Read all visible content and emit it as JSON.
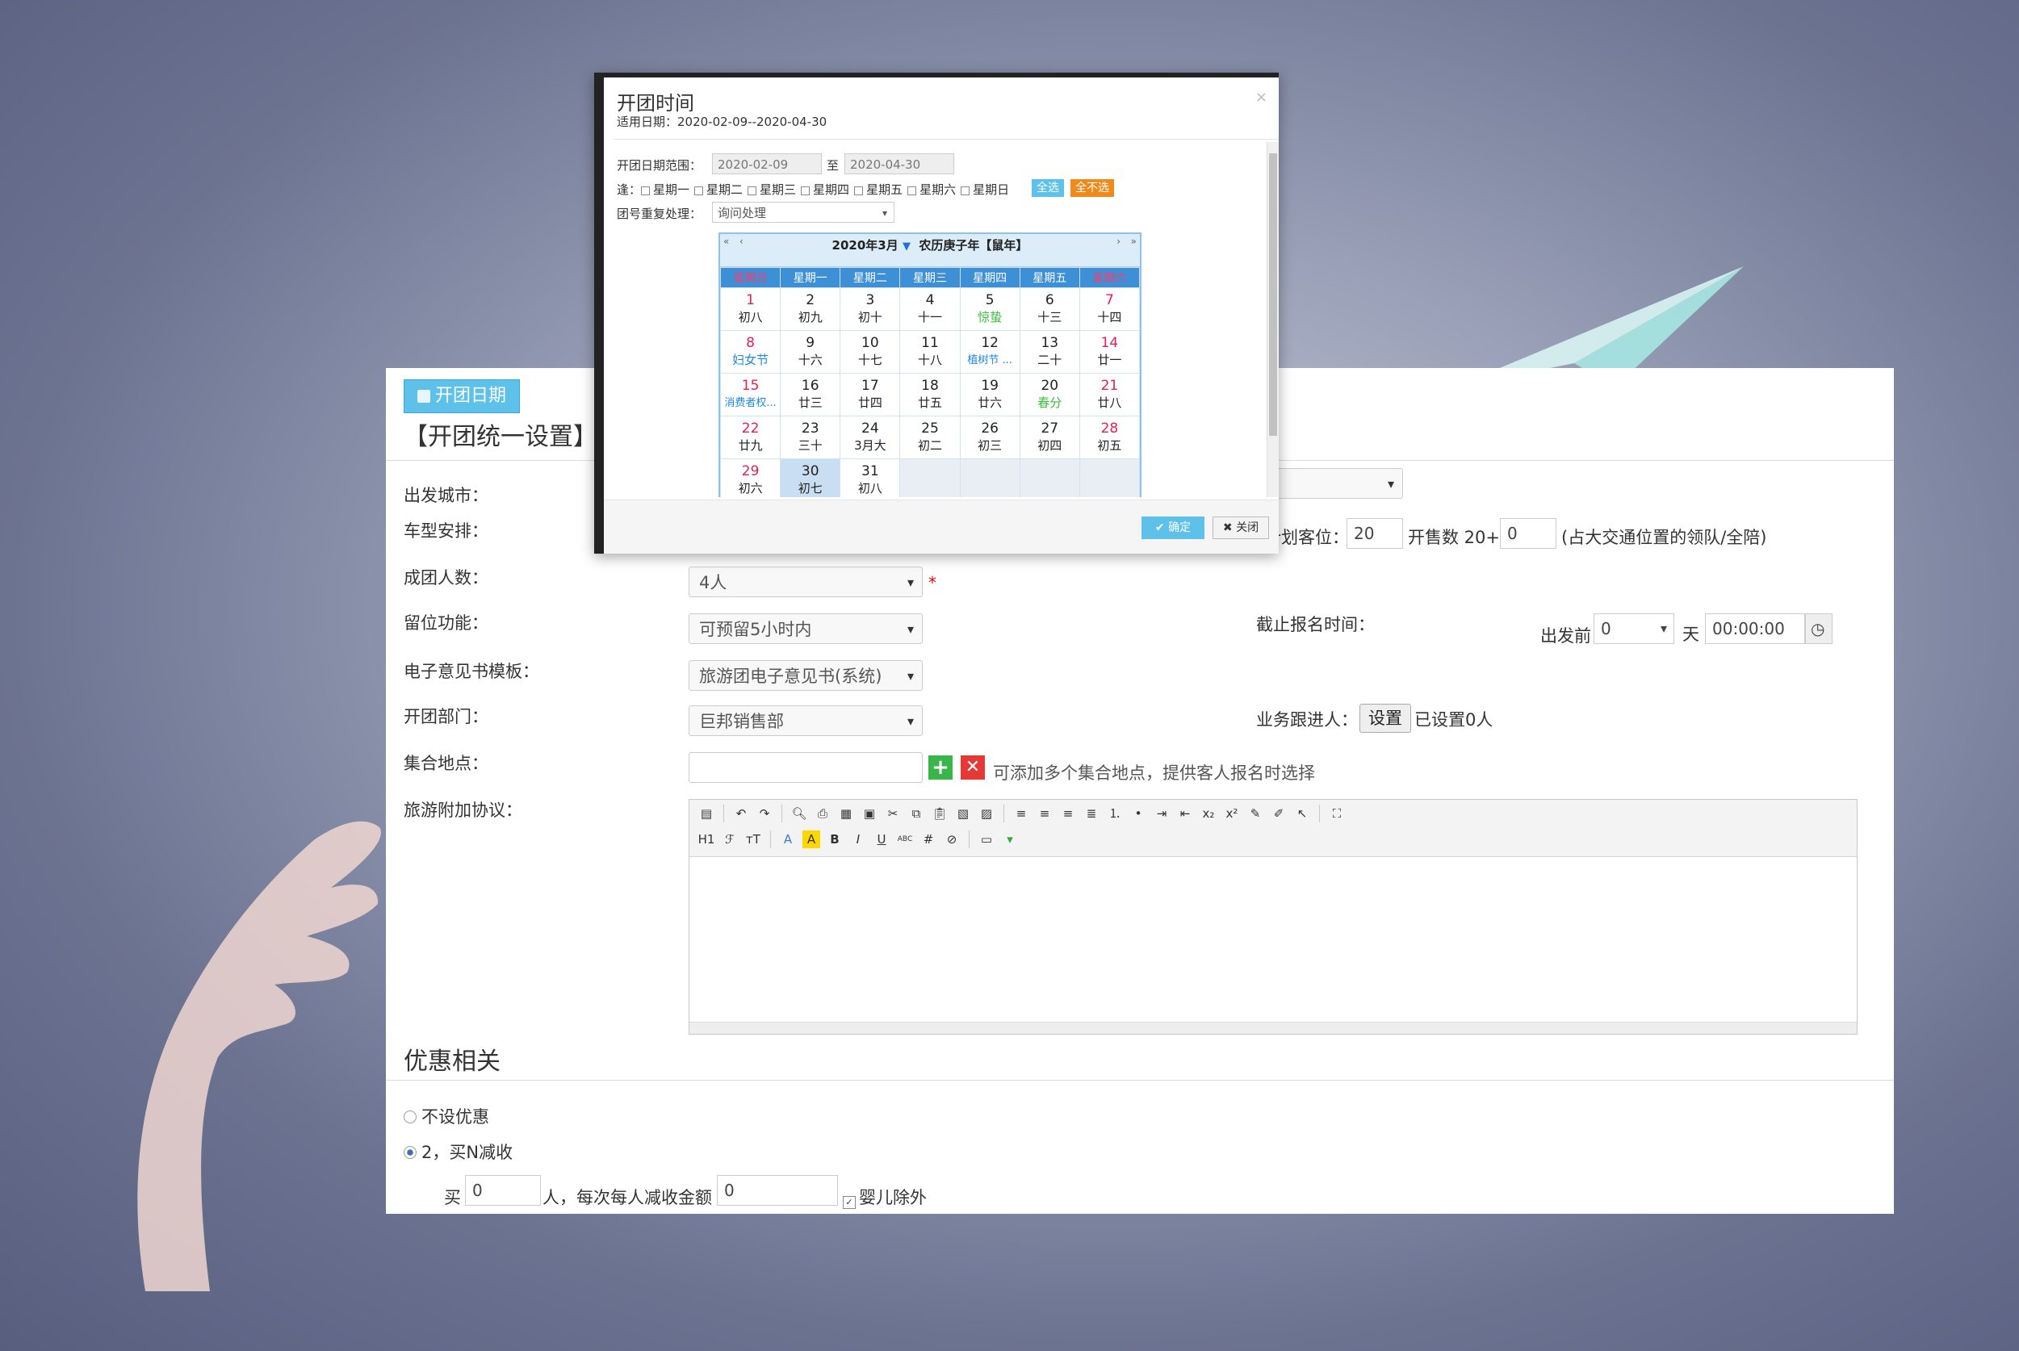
{
  "form": {
    "tab_label": "开团日期",
    "section_title": "【开团统一设置】注",
    "labels": {
      "city": "出发城市：",
      "vehicle": "车型安排：",
      "group_size": "成团人数：",
      "hold": "留位功能：",
      "feedback": "电子意见书模板：",
      "dept": "开团部门：",
      "meeting": "集合地点：",
      "agreement": "旅游附加协议："
    },
    "values": {
      "group_size": "4人",
      "hold": "可预留5小时内",
      "feedback": "旅游团电子意见书(系统)",
      "dept": "巨邦销售部",
      "meeting": ""
    },
    "seat_plan": {
      "label": "计划客位：",
      "seats": "20",
      "open_label": "开售数 20+",
      "open_extra": "0",
      "note": "(占大交通位置的领队/全陪)"
    },
    "deadline": {
      "label": "截止报名时间：",
      "before": "出发前",
      "days": "0",
      "day_unit": "天",
      "time": "00:00:00"
    },
    "follower": {
      "label": "业务跟进人：",
      "button": "设置",
      "status": "已设置0人"
    },
    "meeting_hint": "可添加多个集合地点，提供客人报名时选择",
    "discount": {
      "title": "优惠相关",
      "option_none": "不设优惠",
      "option_buy": "2，买N减收",
      "buy_prefix": "买",
      "buy_n": "0",
      "buy_mid": "人，每次每人减收金额",
      "amount": "0",
      "infant_excluded": "婴儿除外"
    }
  },
  "modal": {
    "title": "开团时间",
    "subtitle": "适用日期：2020-02-09--2020-04-30",
    "range_label": "开团日期范围：",
    "range_from": "2020-02-09",
    "range_to_label": "至",
    "range_to": "2020-04-30",
    "weekday_prefix": "逢：",
    "weekday_options": [
      "星期一",
      "星期二",
      "星期三",
      "星期四",
      "星期五",
      "星期六",
      "星期日"
    ],
    "select_all": "全选",
    "select_none": "全不选",
    "repeat_label": "团号重复处理：",
    "repeat_value": "询问处理",
    "ok": "确定",
    "close": "关闭",
    "calendar": {
      "year_month": "2020年3月",
      "lunar": "农历庚子年【鼠年】",
      "weekdays": [
        "星期日",
        "星期一",
        "星期二",
        "星期三",
        "星期四",
        "星期五",
        "星期六"
      ],
      "weeks": [
        [
          {
            "d": "1",
            "l": "初八"
          },
          {
            "d": "2",
            "l": "初九"
          },
          {
            "d": "3",
            "l": "初十"
          },
          {
            "d": "4",
            "l": "十一"
          },
          {
            "d": "5",
            "l": "惊蛰"
          },
          {
            "d": "6",
            "l": "十三"
          },
          {
            "d": "7",
            "l": "十四"
          }
        ],
        [
          {
            "d": "8",
            "l": "妇女节"
          },
          {
            "d": "9",
            "l": "十六"
          },
          {
            "d": "10",
            "l": "十七"
          },
          {
            "d": "11",
            "l": "十八"
          },
          {
            "d": "12",
            "l": "植树节 ..."
          },
          {
            "d": "13",
            "l": "二十"
          },
          {
            "d": "14",
            "l": "廿一"
          }
        ],
        [
          {
            "d": "15",
            "l": "消费者权..."
          },
          {
            "d": "16",
            "l": "廿三"
          },
          {
            "d": "17",
            "l": "廿四"
          },
          {
            "d": "18",
            "l": "廿五"
          },
          {
            "d": "19",
            "l": "廿六"
          },
          {
            "d": "20",
            "l": "春分"
          },
          {
            "d": "21",
            "l": "廿八"
          }
        ],
        [
          {
            "d": "22",
            "l": "廿九"
          },
          {
            "d": "23",
            "l": "三十"
          },
          {
            "d": "24",
            "l": "3月大"
          },
          {
            "d": "25",
            "l": "初二"
          },
          {
            "d": "26",
            "l": "初三"
          },
          {
            "d": "27",
            "l": "初四"
          },
          {
            "d": "28",
            "l": "初五"
          }
        ],
        [
          {
            "d": "29",
            "l": "初六"
          },
          {
            "d": "30",
            "l": "初七"
          },
          {
            "d": "31",
            "l": "初八"
          },
          {
            "d": "",
            "l": ""
          },
          {
            "d": "",
            "l": ""
          },
          {
            "d": "",
            "l": ""
          },
          {
            "d": "",
            "l": ""
          }
        ]
      ],
      "colors": {
        "holiday": "#1e88e5",
        "term": "#3cbf3c",
        "weekend": "#e81e55"
      }
    }
  }
}
